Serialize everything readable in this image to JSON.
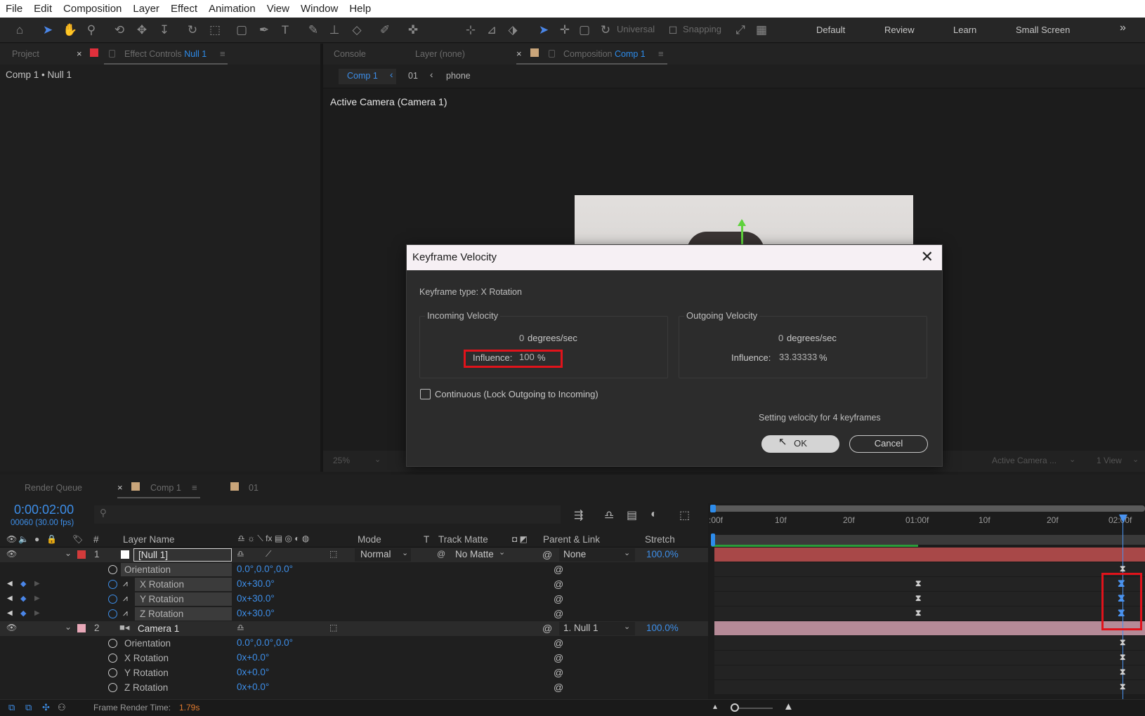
{
  "menu": [
    "File",
    "Edit",
    "Composition",
    "Layer",
    "Effect",
    "Animation",
    "View",
    "Window",
    "Help"
  ],
  "toolbar": {
    "universal_label": "Universal",
    "snapping_label": "Snapping",
    "workspaces": [
      "Default",
      "Review",
      "Learn",
      "Small Screen"
    ],
    "more": "»"
  },
  "left_panel": {
    "tab_project": "Project",
    "tab_effect_controls": "Effect Controls",
    "tab_effect_controls_target": "Null 1",
    "breadcrumb": "Comp 1 • Null 1"
  },
  "viewer": {
    "tab_console": "Console",
    "tab_layer": "Layer (none)",
    "tab_composition": "Composition",
    "tab_composition_target": "Comp 1",
    "nav": [
      "Comp 1",
      "01",
      "phone"
    ],
    "active_camera": "Active Camera (Camera 1)",
    "zoom": "25%",
    "view_camera": "Active Camera ...",
    "view_layout": "1 View"
  },
  "dialog": {
    "title": "Keyframe Velocity",
    "keyframe_type": "Keyframe type: X Rotation",
    "incoming": {
      "legend": "Incoming Velocity",
      "value": "0",
      "unit": "degrees/sec",
      "influence_label": "Influence:",
      "influence_value": "100",
      "influence_unit": "%"
    },
    "outgoing": {
      "legend": "Outgoing Velocity",
      "value": "0",
      "unit": "degrees/sec",
      "influence_label": "Influence:",
      "influence_value": "33.33333",
      "influence_unit": "%"
    },
    "continuous_label": "Continuous (Lock Outgoing to Incoming)",
    "continuous_checked": false,
    "status": "Setting velocity for 4 keyframes",
    "ok": "OK",
    "cancel": "Cancel"
  },
  "timeline_tabs": {
    "render_queue": "Render Queue",
    "comp1": "Comp 1",
    "comp01": "01"
  },
  "timeline": {
    "timecode": "0:00:02:00",
    "frame_info": "00060 (30.00 fps)",
    "columns": {
      "num": "#",
      "layer_name": "Layer Name",
      "mode": "Mode",
      "t": "T",
      "track_matte": "Track Matte",
      "parent": "Parent & Link",
      "stretch": "Stretch"
    },
    "ruler": [
      ":00f",
      "10f",
      "20f",
      "01:00f",
      "10f",
      "20f",
      "02:00f"
    ],
    "layers": [
      {
        "num": "1",
        "name": "[Null 1]",
        "mode": "Normal",
        "matte": "No Matte",
        "parent": "None",
        "stretch": "100.0%",
        "props": [
          {
            "name": "Orientation",
            "value": "0.0°,0.0°,0.0°"
          },
          {
            "name": "X Rotation",
            "value": "0x+30.0°"
          },
          {
            "name": "Y Rotation",
            "value": "0x+30.0°"
          },
          {
            "name": "Z Rotation",
            "value": "0x+30.0°"
          }
        ]
      },
      {
        "num": "2",
        "name": "Camera 1",
        "parent": "1. Null 1",
        "stretch": "100.0%",
        "props": [
          {
            "name": "Orientation",
            "value": "0.0°,0.0°,0.0°"
          },
          {
            "name": "X Rotation",
            "value": "0x+0.0°"
          },
          {
            "name": "Y Rotation",
            "value": "0x+0.0°"
          },
          {
            "name": "Z Rotation",
            "value": "0x+0.0°"
          }
        ]
      }
    ],
    "footer": {
      "render_time_label": "Frame Render Time:",
      "render_time_value": "1.79s"
    }
  },
  "colors": {
    "accent": "#2d8ceb",
    "highlight_red": "#e0131b",
    "layer1_bar": "#b04a4a",
    "layer2_bar": "#b58a97",
    "work_area": "#2b9c3a"
  }
}
